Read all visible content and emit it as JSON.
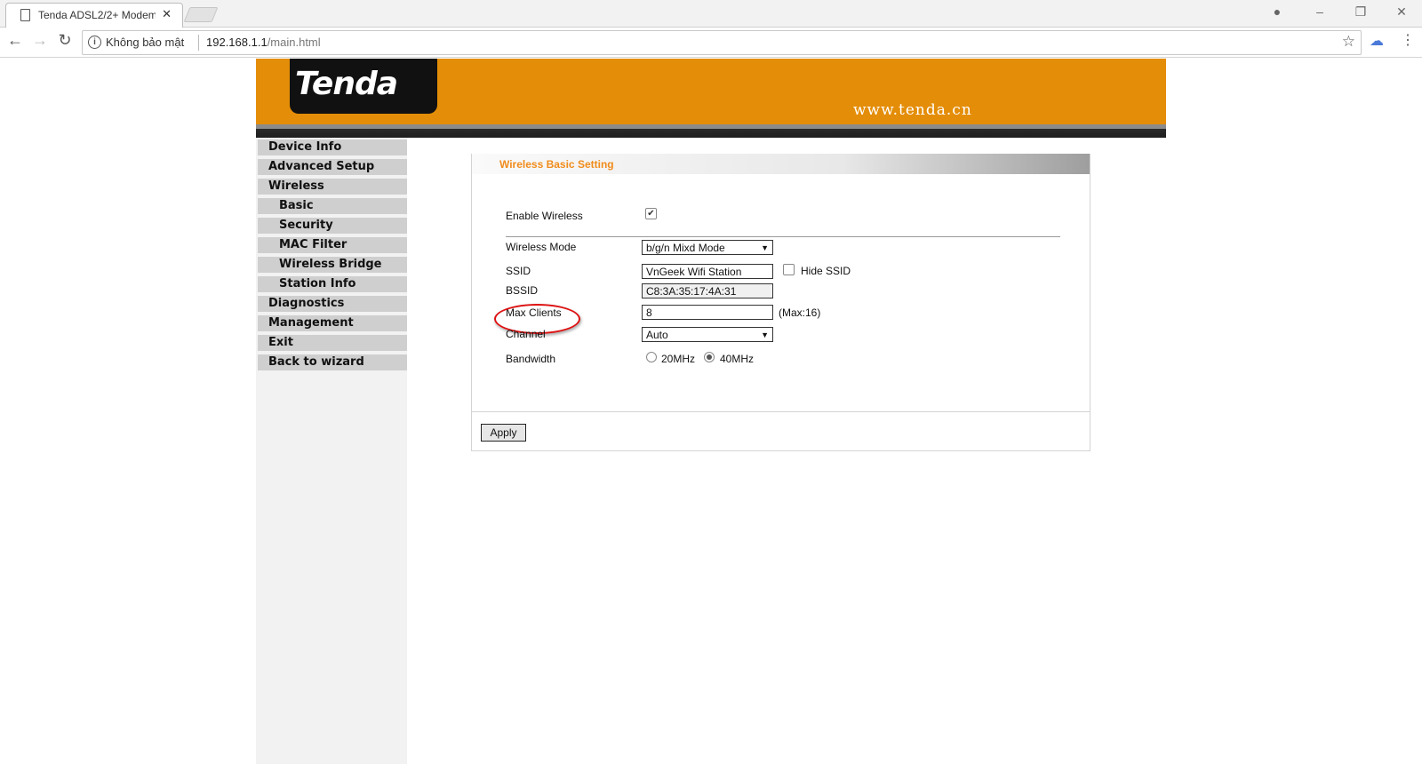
{
  "browser": {
    "tab_title": "Tenda ADSL2/2+ Modem",
    "security_label": "Không bảo mật",
    "url_host": "192.168.1.1",
    "url_path": "/main.html"
  },
  "header": {
    "logo_text": "Tenda",
    "site_text": "www.tenda.cn"
  },
  "sidebar": {
    "items": [
      {
        "label": "Device Info"
      },
      {
        "label": "Advanced Setup"
      },
      {
        "label": "Wireless"
      },
      {
        "label": "Basic"
      },
      {
        "label": "Security"
      },
      {
        "label": "MAC Filter"
      },
      {
        "label": "Wireless Bridge"
      },
      {
        "label": "Station Info"
      },
      {
        "label": "Diagnostics"
      },
      {
        "label": "Management"
      },
      {
        "label": "Exit"
      },
      {
        "label": "Back to wizard"
      }
    ]
  },
  "form": {
    "title": "Wireless Basic Setting",
    "enable_wireless_label": "Enable Wireless",
    "enable_wireless_checked": true,
    "mode_label": "Wireless Mode",
    "mode_value": "b/g/n Mixd Mode",
    "ssid_label": "SSID",
    "ssid_value": "VnGeek Wifi Station",
    "hide_ssid_label": "Hide SSID",
    "bssid_label": "BSSID",
    "bssid_value": "C8:3A:35:17:4A:31",
    "max_clients_label": "Max Clients",
    "max_clients_value": "8",
    "max_clients_note": "(Max:16)",
    "channel_label": "Channel",
    "channel_value": "Auto",
    "bandwidth_label": "Bandwidth",
    "bandwidth_20": "20MHz",
    "bandwidth_40": "40MHz",
    "bandwidth_selected": "40MHz",
    "apply_label": "Apply"
  },
  "colors": {
    "banner": "#e48d08",
    "title": "#f08c1c",
    "highlight": "#dd1111"
  }
}
